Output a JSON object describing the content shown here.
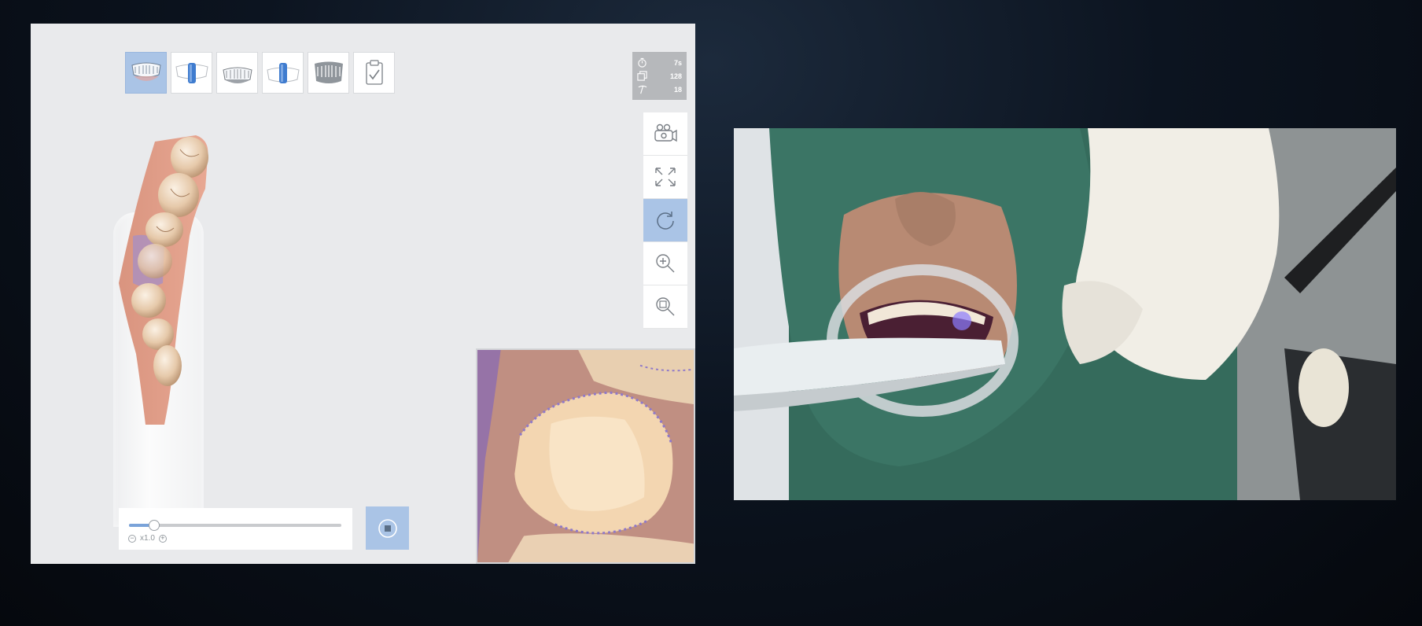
{
  "scanner": {
    "workflow_steps": [
      {
        "name": "Upper jaw scan",
        "icon": "upper-jaw-icon",
        "active": true
      },
      {
        "name": "Upper scan body",
        "icon": "scan-body-icon",
        "active": false
      },
      {
        "name": "Lower jaw scan",
        "icon": "lower-jaw-icon",
        "active": false
      },
      {
        "name": "Lower scan body",
        "icon": "scan-body-icon",
        "active": false
      },
      {
        "name": "Occlusion scan",
        "icon": "bite-icon",
        "active": false
      },
      {
        "name": "Check / complete",
        "icon": "clipboard-check-icon",
        "active": false
      }
    ],
    "stats": {
      "time": "7s",
      "frames": "128",
      "count": "18"
    },
    "view_tools": [
      {
        "icon": "camera-view-icon",
        "active": false
      },
      {
        "icon": "fit-to-screen-icon",
        "active": false
      },
      {
        "icon": "rotate-icon",
        "active": true
      },
      {
        "icon": "zoom-in-icon",
        "active": false
      },
      {
        "icon": "zoom-region-icon",
        "active": false
      }
    ],
    "speed": {
      "slider_fraction": 0.12,
      "zoom_label": "x1.0",
      "minus_label": "−",
      "plus_label": "+"
    },
    "colors": {
      "accent": "#aac4e6",
      "panel_bg": "#e9eaec",
      "stats_bg": "#b6b8bb"
    }
  }
}
